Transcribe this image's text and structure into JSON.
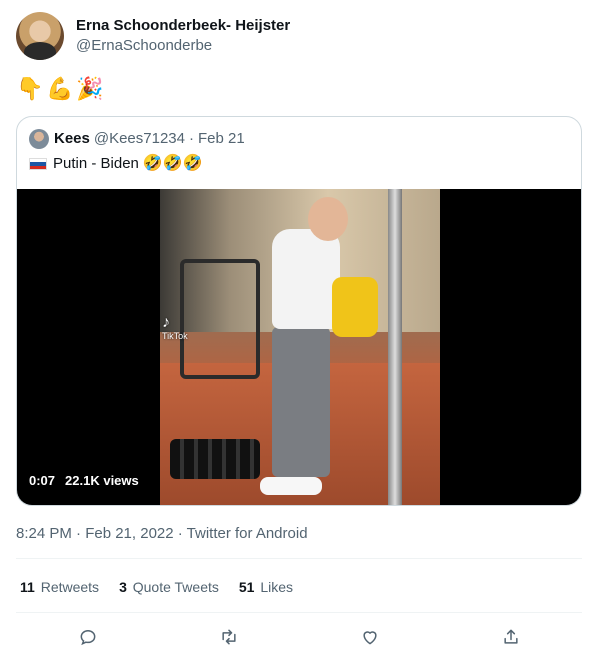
{
  "author": {
    "display_name": "Erna Schoonderbeek- Heijster",
    "handle": "@ErnaSchoonderbe"
  },
  "tweet": {
    "emojis": [
      "👇",
      "💪",
      "🎉"
    ]
  },
  "quoted_tweet": {
    "name": "Kees",
    "handle": "@Kees71234",
    "separator": "·",
    "date": "Feb 21",
    "flag_icon": "russia-flag-icon",
    "text": "Putin - Biden",
    "laugh_emojis": "🤣🤣🤣",
    "video": {
      "duration": "0:07",
      "views": "22.1K views",
      "watermark": "TikTok"
    }
  },
  "meta": {
    "timestamp": "8:24 PM · Feb 21, 2022 · Twitter for Android"
  },
  "stats": {
    "retweets_count": "11",
    "retweets_label": "Retweets",
    "quote_count": "3",
    "quote_label": "Quote Tweets",
    "likes_count": "51",
    "likes_label": "Likes"
  },
  "actions": {
    "reply": "reply-icon",
    "retweet": "retweet-icon",
    "like": "heart-icon",
    "share": "share-icon"
  },
  "colors": {
    "text": "#0f1419",
    "secondary": "#536471",
    "border": "#cfd9de"
  }
}
